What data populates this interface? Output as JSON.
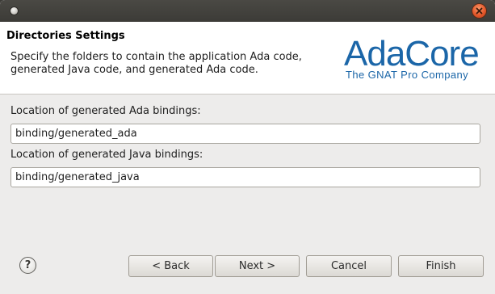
{
  "window": {
    "title": ""
  },
  "banner": {
    "title": "Directories Settings",
    "description": "Specify the folders to contain the application Ada code, generated Java code, and generated Ada code.",
    "logo": {
      "wordmark": "AdaCore",
      "tagline": "The GNAT Pro Company",
      "color": "#1b66a8"
    }
  },
  "form": {
    "ada_bindings_label": "Location of generated Ada bindings:",
    "ada_bindings_value": "binding/generated_ada",
    "java_bindings_label": "Location of generated Java bindings:",
    "java_bindings_value": "binding/generated_java"
  },
  "footer": {
    "help_glyph": "?",
    "back_label": "< Back",
    "next_label": "Next >",
    "cancel_label": "Cancel",
    "finish_label": "Finish"
  },
  "colors": {
    "titlebar": "#3c3b37",
    "dialog_background": "#edeceb",
    "close_button": "#e4572a"
  }
}
